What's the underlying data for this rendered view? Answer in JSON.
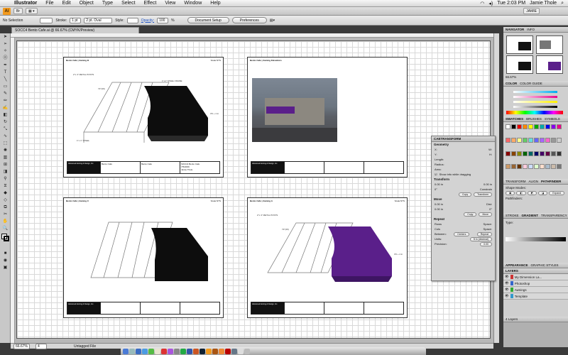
{
  "menubar": {
    "app": "Illustrator",
    "items": [
      "File",
      "Edit",
      "Object",
      "Type",
      "Select",
      "Effect",
      "View",
      "Window",
      "Help"
    ],
    "clock": "Tue 2:03 PM",
    "user": "Jamie Thole"
  },
  "appbar": {
    "logo": "Ai",
    "workspace": "JAMIE"
  },
  "control": {
    "selection": "No Selection",
    "stroke_label": "Stroke:",
    "stroke_value": "1 pt",
    "brush_value": "2 pt. Oval",
    "style_label": "Style:",
    "opacity_label": "Opacity:",
    "opacity_value": "100",
    "opacity_unit": "%",
    "doc_setup": "Document Setup",
    "preferences": "Preferences"
  },
  "document": {
    "tab": "SOCC4 Bento Cafe.ai @ 66.67% (CMYK/Preview)"
  },
  "status": {
    "zoom": "66.67%",
    "page": "4",
    "info": "Untagged File"
  },
  "artboards": [
    {
      "title": "Bento Cafe | Awning B",
      "scale": "Scale:NTS",
      "awning_color": "#0d0d0d",
      "project": "Bento Cafe",
      "client": "Bento Cafe",
      "file": "SOCC4 Bento Cafe",
      "date": "7/5/2009",
      "drawn": "Jamie Thole"
    },
    {
      "title": "Bento Cafe | Awning Elevations",
      "scale": "",
      "photo": true
    },
    {
      "title": "Bento Cafe | Awning C",
      "scale": "Scale:NTS",
      "awning_color": "#0d0d0d"
    },
    {
      "title": "Bento Cafe | Awning A",
      "scale": "Scale:NTS",
      "awning_color": "#5a1f8a"
    }
  ],
  "pathfinder": {
    "tabs": [
      "CAETRANSFORM",
      "CAETRANSFORM"
    ],
    "geometry": "Geometry",
    "labels": [
      "X:",
      "Y:",
      "W:",
      "H:",
      "Length:",
      "Radius:",
      "Area:"
    ],
    "show_info": "Show info while dragging",
    "transform": "Transform",
    "rotate": "0°",
    "scale": "0.00 in",
    "constrain": "Constrain",
    "copy": "Copy",
    "transform_btn": "Transform",
    "move": "Move",
    "dist": "Dist:",
    "move_btn": "Move",
    "repeat": "Repeat",
    "rows": "Rows",
    "cols": "Cols",
    "space": "Space:",
    "between": "Between:",
    "center": "Centers",
    "repeat_btn": "Repeat",
    "units": "Units:",
    "units_value": "ft in (decimal)",
    "precision": "Precision:",
    "precision_value": "0.00"
  },
  "rpanels": {
    "navigator": {
      "tabs": [
        "NAVIGATOR",
        "INFO"
      ]
    },
    "zoom": "66.67%",
    "color": {
      "tabs": [
        "COLOR",
        "COLOR GUIDE"
      ]
    },
    "swatches": {
      "tabs": [
        "SWATCHES",
        "BRUSHES",
        "SYMBOLS"
      ]
    },
    "transform": {
      "tabs": [
        "TRANSFORM",
        "ALIGN",
        "PATHFINDER"
      ],
      "shape_modes": "Shape Modes:",
      "expand": "Expand",
      "pathfinders": "Pathfinders:"
    },
    "stroke": {
      "tabs": [
        "STROKE",
        "GRADIENT",
        "TRANSPARENCY"
      ],
      "type": "Type:"
    },
    "appearance": {
      "tabs": [
        "APPEARANCE",
        "GRAPHIC STYLES"
      ]
    },
    "layers": {
      "title": "LAYERS",
      "items": [
        "My Dimension La...",
        "Photoshop",
        "Awnings",
        "Template"
      ],
      "count": "4 Layers"
    }
  }
}
